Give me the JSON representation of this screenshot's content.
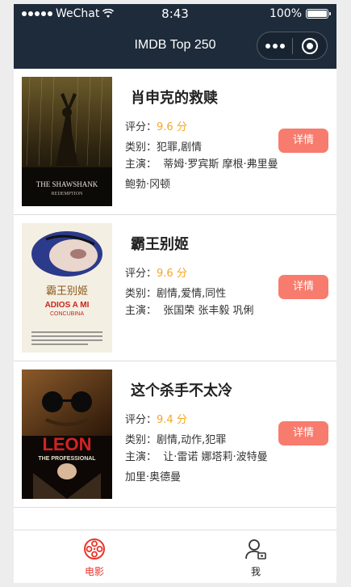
{
  "status_bar": {
    "carrier": "WeChat",
    "time": "8:43",
    "battery": "100%"
  },
  "nav": {
    "title": "IMDB Top 250"
  },
  "movies": [
    {
      "title": "肖申克的救赎",
      "score_label": "评分：",
      "score": "9.6 分",
      "genre_label": "类别：",
      "genre": "犯罪,剧情",
      "cast_label": "主演：",
      "cast": "蒂姆·罗宾斯 摩根·弗里曼 鲍勃·冈顿",
      "detail_label": "详情",
      "poster_icon": "shawshank-poster"
    },
    {
      "title": "霸王别姬",
      "score_label": "评分：",
      "score": "9.6 分",
      "genre_label": "类别：",
      "genre": "剧情,爱情,同性",
      "cast_label": "主演：",
      "cast": "张国荣 张丰毅 巩俐",
      "detail_label": "详情",
      "poster_icon": "farewell-my-concubine-poster"
    },
    {
      "title": "这个杀手不太冷",
      "score_label": "评分：",
      "score": "9.4 分",
      "genre_label": "类别：",
      "genre": "剧情,动作,犯罪",
      "cast_label": "主演：",
      "cast": "让·雷诺 娜塔莉·波特曼 加里·奥德曼",
      "detail_label": "详情",
      "poster_icon": "leon-poster"
    }
  ],
  "posters": {
    "shawshank": {
      "top": "THE SHAWSHANK",
      "bottom": "REDEMPTION"
    },
    "concubine": {
      "cn": "霸王别姬",
      "en": "ADIOS A MI",
      "en2": "CONCUBINA"
    },
    "leon": {
      "name": "LEON",
      "sub": "THE PROFESSIONAL"
    }
  },
  "tabbar": {
    "movies_label": "电影",
    "me_label": "我"
  },
  "colors": {
    "nav_bg": "#1d2b3a",
    "accent": "#e8352a",
    "score": "#f5a623",
    "detail_button": "#f77c6e"
  }
}
